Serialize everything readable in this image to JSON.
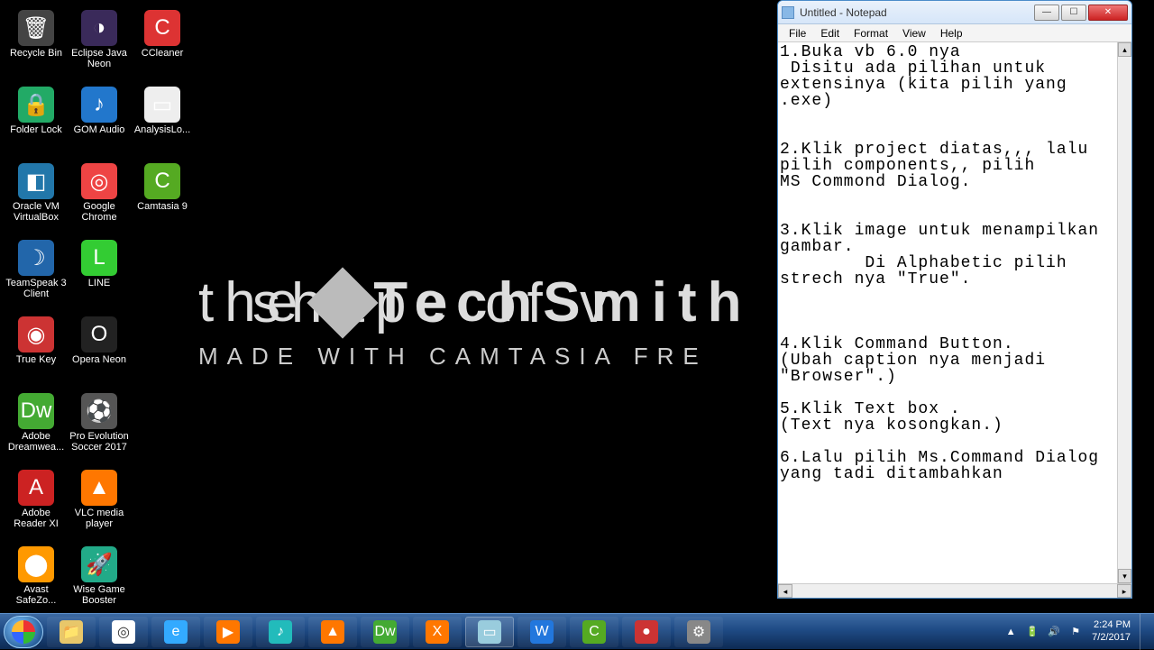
{
  "desktop": {
    "icons": [
      {
        "label": "Recycle Bin",
        "glyph": "🗑",
        "bg": "#444"
      },
      {
        "label": "Eclipse Java Neon",
        "glyph": "◑",
        "bg": "#3a2a5a"
      },
      {
        "label": "CCleaner",
        "glyph": "C",
        "bg": "#d33"
      },
      {
        "label": "Folder Lock",
        "glyph": "🔒",
        "bg": "#2a6"
      },
      {
        "label": "GOM Audio",
        "glyph": "♪",
        "bg": "#27c"
      },
      {
        "label": "AnalysisLo...",
        "glyph": "▭",
        "bg": "#eee"
      },
      {
        "label": "Oracle VM VirtualBox",
        "glyph": "◧",
        "bg": "#27a"
      },
      {
        "label": "Google Chrome",
        "glyph": "◎",
        "bg": "#e44"
      },
      {
        "label": "Camtasia 9",
        "glyph": "C",
        "bg": "#5a2"
      },
      {
        "label": "TeamSpeak 3 Client",
        "glyph": "☽",
        "bg": "#26a"
      },
      {
        "label": "LINE",
        "glyph": "L",
        "bg": "#3c3"
      },
      {
        "label": "",
        "glyph": "",
        "bg": "transparent"
      },
      {
        "label": "True Key",
        "glyph": "◉",
        "bg": "#c33"
      },
      {
        "label": "Opera Neon",
        "glyph": "O",
        "bg": "#222"
      },
      {
        "label": "",
        "glyph": "",
        "bg": "transparent"
      },
      {
        "label": "Adobe Dreamwea...",
        "glyph": "Dw",
        "bg": "#4a3"
      },
      {
        "label": "Pro Evolution Soccer 2017",
        "glyph": "⚽",
        "bg": "#555"
      },
      {
        "label": "",
        "glyph": "",
        "bg": "transparent"
      },
      {
        "label": "Adobe Reader XI",
        "glyph": "A",
        "bg": "#c22"
      },
      {
        "label": "VLC media player",
        "glyph": "▲",
        "bg": "#f70"
      },
      {
        "label": "",
        "glyph": "",
        "bg": "transparent"
      },
      {
        "label": "Avast SafeZo...",
        "glyph": "⬤",
        "bg": "#f90"
      },
      {
        "label": "Wise Game Booster",
        "glyph": "🚀",
        "bg": "#2a8"
      }
    ]
  },
  "watermark": {
    "line1_left": "the",
    "brand": "TechSmith",
    "line1_right": "shape of v",
    "line2": "MADE WITH CAMTASIA FRE"
  },
  "notepad": {
    "title": "Untitled - Notepad",
    "menu": [
      "File",
      "Edit",
      "Format",
      "View",
      "Help"
    ],
    "content": "1.Buka vb 6.0 nya\n Disitu ada pilihan untuk extensinya (kita pilih yang .exe)\n\n\n2.Klik project diatas,,, lalu pilih components,, pilih\nMS Commond Dialog.\n\n\n3.Klik image untuk menampilkan gambar.\n        Di Alphabetic pilih strech nya \"True\".\n\n\n\n4.Klik Command Button.\n(Ubah caption nya menjadi \"Browser\".)\n\n5.Klik Text box .\n(Text nya kosongkan.)\n\n6.Lalu pilih Ms.Command Dialog yang tadi ditambahkan"
  },
  "taskbar": {
    "apps": [
      {
        "name": "file-explorer",
        "bg": "#e8c76a",
        "glyph": "📁"
      },
      {
        "name": "chrome",
        "bg": "#fff",
        "glyph": "◎"
      },
      {
        "name": "ie",
        "bg": "#3af",
        "glyph": "e"
      },
      {
        "name": "gom",
        "bg": "#f70",
        "glyph": "▶"
      },
      {
        "name": "music",
        "bg": "#2bb",
        "glyph": "♪"
      },
      {
        "name": "vlc",
        "bg": "#f70",
        "glyph": "▲"
      },
      {
        "name": "dreamweaver",
        "bg": "#4a3",
        "glyph": "Dw"
      },
      {
        "name": "xampp",
        "bg": "#f70",
        "glyph": "X"
      },
      {
        "name": "notepad",
        "bg": "#9cd",
        "glyph": "▭",
        "active": true
      },
      {
        "name": "word",
        "bg": "#27d",
        "glyph": "W"
      },
      {
        "name": "camtasia",
        "bg": "#5a2",
        "glyph": "C"
      },
      {
        "name": "camtasia-rec",
        "bg": "#c33",
        "glyph": "●"
      },
      {
        "name": "tool",
        "bg": "#888",
        "glyph": "⚙"
      }
    ],
    "tray": {
      "icons": [
        "▲",
        "🔋",
        "🔊",
        "⚑"
      ],
      "time": "2:24 PM",
      "date": "7/2/2017"
    }
  }
}
